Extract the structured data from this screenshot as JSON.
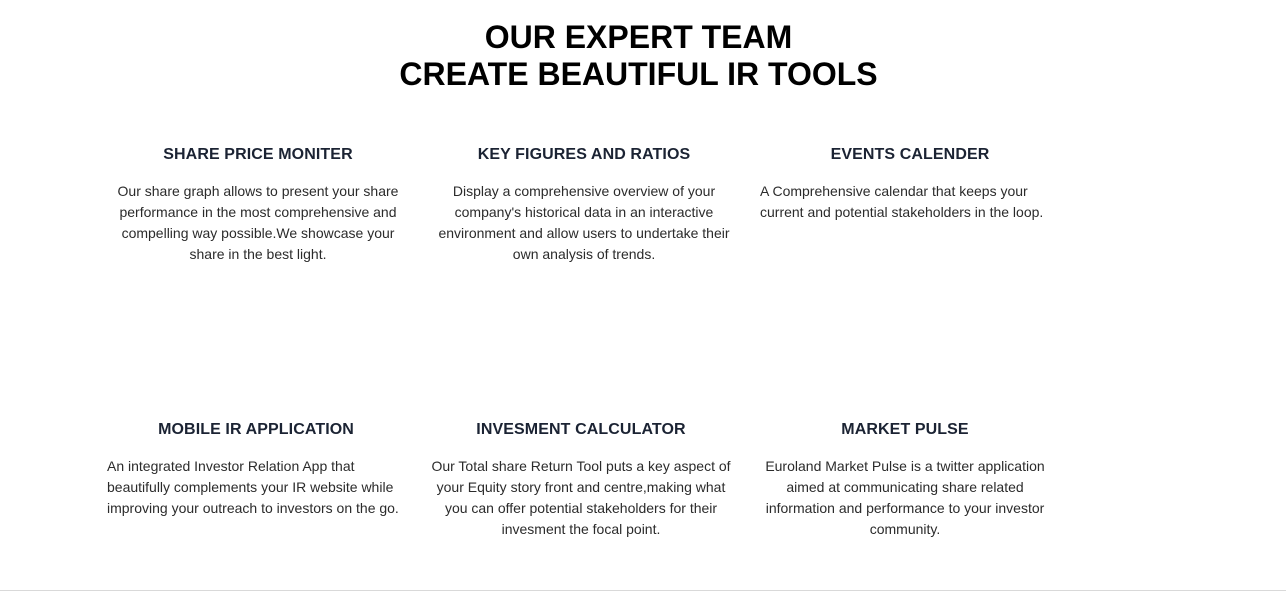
{
  "heading": {
    "line1": "OUR EXPERT TEAM",
    "line2": "CREATE BEAUTIFUL IR TOOLS"
  },
  "tools": [
    {
      "title": "SHARE PRICE MONITER",
      "description": "Our share graph allows to present your share performance in the most comprehensive and compelling way possible.We showcase your share in the best light."
    },
    {
      "title": "KEY FIGURES AND RATIOS",
      "description": "Display a comprehensive overview of your company's historical data in an interactive environment and allow users to undertake their own analysis of trends."
    },
    {
      "title": "EVENTS CALENDER",
      "description": "A Comprehensive calendar that keeps your current and potential stakeholders in the loop."
    },
    {
      "title": "MOBILE IR APPLICATION",
      "description": "An integrated Investor Relation App that beautifully complements your IR website while improving your outreach to investors on the go."
    },
    {
      "title": "INVESMENT CALCULATOR",
      "description": "Our Total share Return Tool puts a key aspect of your Equity story front and centre,making what you can offer potential stakeholders for their invesment the focal point."
    },
    {
      "title": "MARKET PULSE",
      "description": "Euroland Market Pulse is a twitter application aimed at communicating share related information and performance to your investor community."
    }
  ]
}
